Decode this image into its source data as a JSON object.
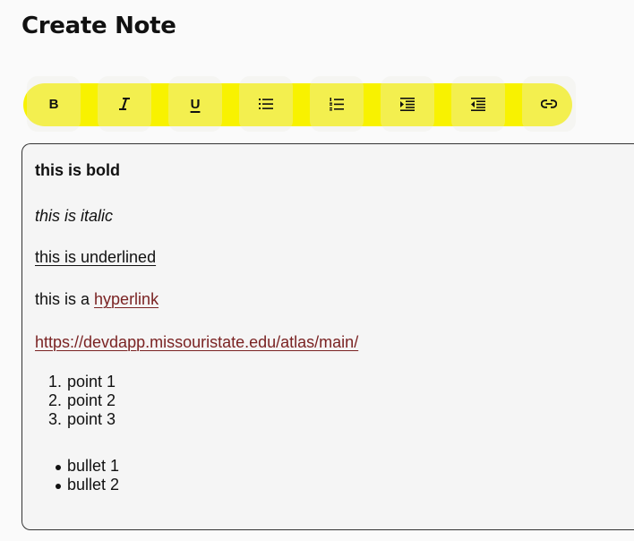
{
  "page": {
    "title": "Create Note"
  },
  "toolbar": {
    "highlight_color": "#f8f200",
    "buttons": [
      {
        "name": "bold",
        "label": "B",
        "icon": "bold-icon"
      },
      {
        "name": "italic",
        "label": "I",
        "icon": "italic-icon"
      },
      {
        "name": "underline",
        "label": "U",
        "icon": "underline-icon"
      },
      {
        "name": "bullet-list",
        "label": "",
        "icon": "bullet-list-icon"
      },
      {
        "name": "numbered-list",
        "label": "",
        "icon": "numbered-list-icon"
      },
      {
        "name": "indent",
        "label": "",
        "icon": "indent-icon"
      },
      {
        "name": "outdent",
        "label": "",
        "icon": "outdent-icon"
      },
      {
        "name": "link",
        "label": "",
        "icon": "link-icon"
      }
    ]
  },
  "editor": {
    "bold_text": "this is bold",
    "italic_text": "this is italic",
    "underline_text": "this is underlined",
    "hyperlink_prefix": "this is a ",
    "hyperlink_text": "hyperlink",
    "url_text": "https://devdapp.missouristate.edu/atlas/main/",
    "ordered_list": [
      {
        "num": "1.",
        "text": "point 1"
      },
      {
        "num": "2.",
        "text": "point 2"
      },
      {
        "num": "3.",
        "text": "point 3"
      }
    ],
    "bullet_list": [
      "bullet 1",
      "bullet 2"
    ],
    "link_color": "#7a2323"
  }
}
